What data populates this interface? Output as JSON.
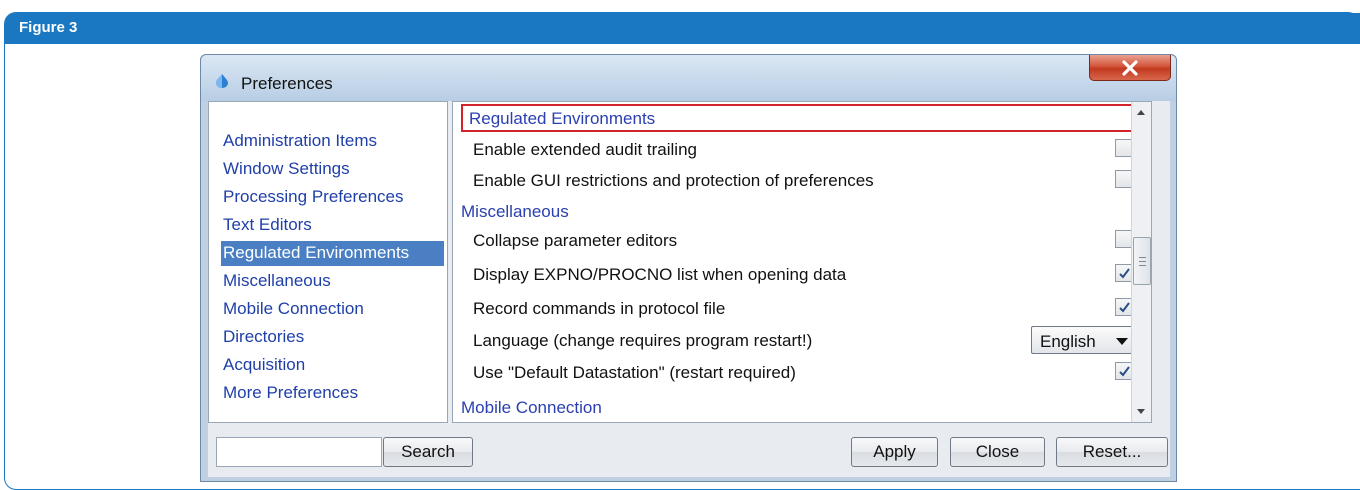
{
  "figure": {
    "title": "Figure 3"
  },
  "window": {
    "title": "Preferences"
  },
  "sidebar": {
    "items": [
      {
        "label": "Administration Items",
        "selected": false
      },
      {
        "label": "Window Settings",
        "selected": false
      },
      {
        "label": "Processing Preferences",
        "selected": false
      },
      {
        "label": "Text Editors",
        "selected": false
      },
      {
        "label": "Regulated Environments",
        "selected": true
      },
      {
        "label": "Miscellaneous",
        "selected": false
      },
      {
        "label": "Mobile Connection",
        "selected": false
      },
      {
        "label": "Directories",
        "selected": false
      },
      {
        "label": "Acquisition",
        "selected": false
      },
      {
        "label": "More Preferences",
        "selected": false
      }
    ]
  },
  "content": {
    "regulated": {
      "header": "Regulated Environments",
      "rows": [
        {
          "label": "Enable extended audit trailing",
          "checked": false
        },
        {
          "label": "Enable GUI restrictions and protection of preferences",
          "checked": false
        }
      ]
    },
    "misc": {
      "header": "Miscellaneous",
      "rows": [
        {
          "label": "Collapse parameter editors",
          "checked": false
        },
        {
          "label": "Display EXPNO/PROCNO list when opening data",
          "checked": true
        },
        {
          "label": "Record commands in protocol file",
          "checked": true
        },
        {
          "label": "Language (change requires program restart!)",
          "value": "English"
        },
        {
          "label": "Use \"Default Datastation\" (restart required)",
          "checked": true
        }
      ]
    },
    "mobile": {
      "header": "Mobile Connection"
    }
  },
  "bottom": {
    "search_value": "",
    "search_button": "Search",
    "apply": "Apply",
    "close": "Close",
    "reset": "Reset..."
  },
  "colors": {
    "figure_accent": "#1a77c2",
    "link_blue": "#1f3fa8",
    "selection": "#4a80c3",
    "highlight_box": "#d2232a"
  }
}
